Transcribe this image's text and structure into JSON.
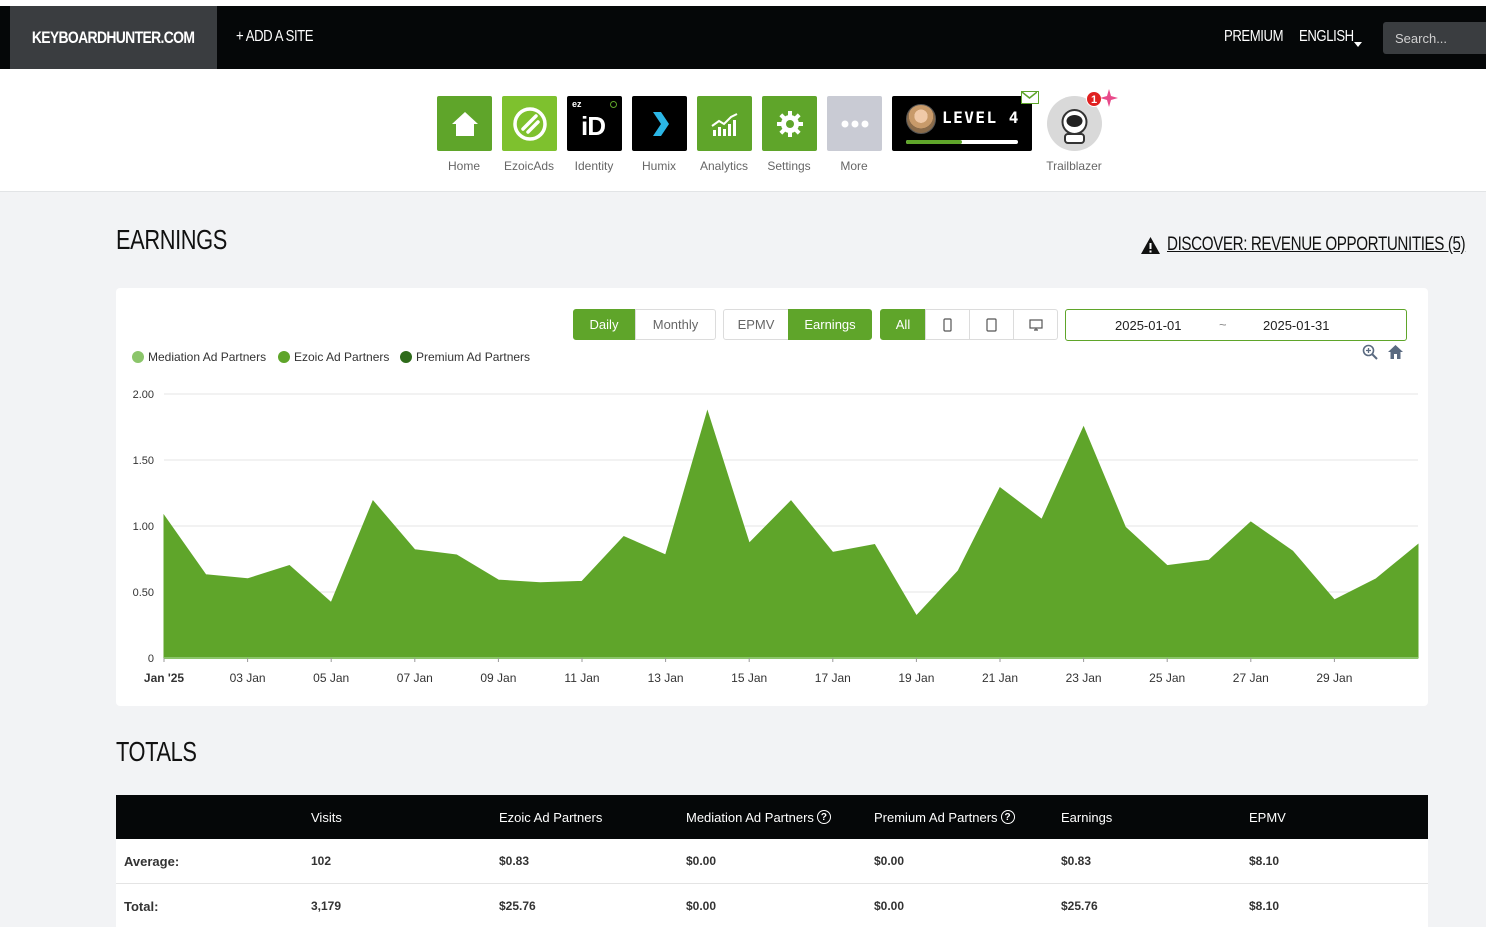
{
  "header": {
    "brand": "KEYBOARDHUNTER.COM",
    "add_site": "+ ADD A SITE",
    "premium": "PREMIUM",
    "language": "ENGLISH",
    "search_placeholder": "Search..."
  },
  "apps": [
    {
      "label": "Home",
      "icon": "home-icon",
      "color": "#5fa52a"
    },
    {
      "label": "EzoicAds",
      "icon": "ezoic-ads-icon",
      "color": "#7ec12e"
    },
    {
      "label": "Identity",
      "icon": "identity-icon",
      "color": "#000000",
      "icon_text": "iD",
      "icon_sub": "ez"
    },
    {
      "label": "Humix",
      "icon": "humix-icon",
      "color": "#000000"
    },
    {
      "label": "Analytics",
      "icon": "analytics-icon",
      "color": "#5fa52a"
    },
    {
      "label": "Settings",
      "icon": "gear-icon",
      "color": "#5fa52a"
    },
    {
      "label": "More",
      "icon": "more-icon",
      "color": "#c9cbd4"
    }
  ],
  "level": {
    "text": "LEVEL 4",
    "progress": 0.5
  },
  "trailblazer": {
    "label": "Trailblazer",
    "badge": "1"
  },
  "earnings": {
    "title": "EARNINGS",
    "discover": "DISCOVER: REVENUE OPPORTUNITIES (5)",
    "period_buttons": [
      "Daily",
      "Monthly"
    ],
    "metric_buttons": [
      "EPMV",
      "Earnings"
    ],
    "device_buttons": [
      "All"
    ],
    "date_from": "2025-01-01",
    "date_sep": "~",
    "date_to": "2025-01-31"
  },
  "chart_data": {
    "type": "area",
    "legend": [
      {
        "name": "Mediation Ad Partners",
        "color": "#8bc56a"
      },
      {
        "name": "Ezoic Ad Partners",
        "color": "#5fa52a"
      },
      {
        "name": "Premium Ad Partners",
        "color": "#2e6b1a"
      }
    ],
    "ylim": [
      0,
      2.0
    ],
    "y_ticks": [
      "0",
      "0.50",
      "1.00",
      "1.50",
      "2.00"
    ],
    "x_tick_labels": [
      "Jan '25",
      "03 Jan",
      "05 Jan",
      "07 Jan",
      "09 Jan",
      "11 Jan",
      "13 Jan",
      "15 Jan",
      "17 Jan",
      "19 Jan",
      "21 Jan",
      "23 Jan",
      "25 Jan",
      "27 Jan",
      "29 Jan"
    ],
    "x": [
      "2025-01-01",
      "2025-01-02",
      "2025-01-03",
      "2025-01-04",
      "2025-01-05",
      "2025-01-06",
      "2025-01-07",
      "2025-01-08",
      "2025-01-09",
      "2025-01-10",
      "2025-01-11",
      "2025-01-12",
      "2025-01-13",
      "2025-01-14",
      "2025-01-15",
      "2025-01-16",
      "2025-01-17",
      "2025-01-18",
      "2025-01-19",
      "2025-01-20",
      "2025-01-21",
      "2025-01-22",
      "2025-01-23",
      "2025-01-24",
      "2025-01-25",
      "2025-01-26",
      "2025-01-27",
      "2025-01-28",
      "2025-01-29",
      "2025-01-30",
      "2025-01-31"
    ],
    "series": [
      {
        "name": "Ezoic Ad Partners",
        "color": "#5fa52a",
        "values": [
          1.08,
          0.63,
          0.6,
          0.7,
          0.42,
          1.19,
          0.82,
          0.78,
          0.59,
          0.57,
          0.58,
          0.92,
          0.78,
          1.87,
          0.87,
          1.19,
          0.8,
          0.86,
          0.32,
          0.66,
          1.29,
          1.05,
          1.75,
          0.99,
          0.7,
          0.74,
          1.03,
          0.81,
          0.44,
          0.6,
          0.86
        ]
      }
    ]
  },
  "totals": {
    "title": "TOTALS",
    "columns": [
      "",
      "Visits",
      "Ezoic Ad Partners",
      "Mediation Ad Partners",
      "Premium Ad Partners",
      "Earnings",
      "EPMV"
    ],
    "rows": [
      [
        "Average:",
        "102",
        "$0.83",
        "$0.00",
        "$0.00",
        "$0.83",
        "$8.10"
      ],
      [
        "Total:",
        "3,179",
        "$25.76",
        "$0.00",
        "$0.00",
        "$25.76",
        "$8.10"
      ]
    ]
  }
}
